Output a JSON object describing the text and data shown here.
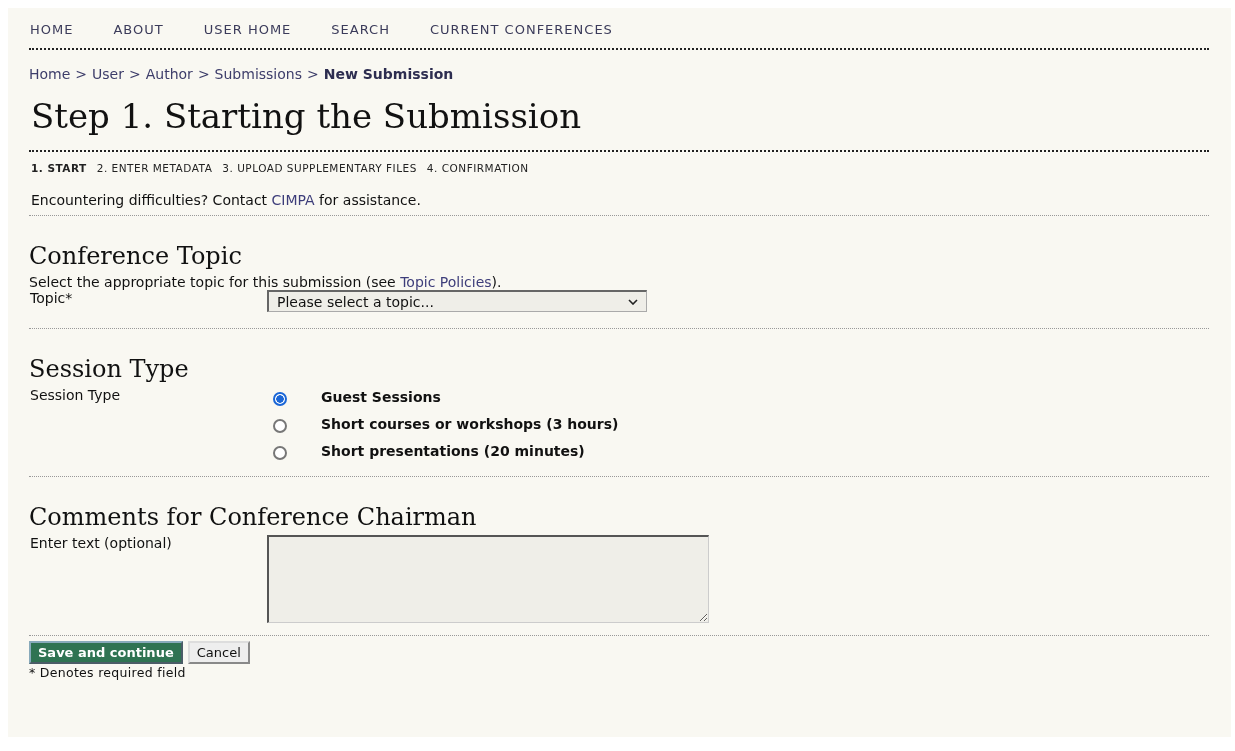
{
  "nav": [
    {
      "label": "HOME"
    },
    {
      "label": "ABOUT"
    },
    {
      "label": "USER HOME"
    },
    {
      "label": "SEARCH"
    },
    {
      "label": "CURRENT CONFERENCES"
    }
  ],
  "breadcrumb": [
    {
      "label": "Home",
      "current": false
    },
    {
      "label": "User",
      "current": false
    },
    {
      "label": "Author",
      "current": false
    },
    {
      "label": "Submissions",
      "current": false
    },
    {
      "label": "New Submission",
      "current": true
    }
  ],
  "breadcrumb_separator": ">",
  "title": "Step 1. Starting the Submission",
  "steps": [
    {
      "label": "1. START",
      "selected": true
    },
    {
      "label": "2. ENTER METADATA",
      "selected": false
    },
    {
      "label": "3. UPLOAD SUPPLEMENTARY FILES",
      "selected": false
    },
    {
      "label": "4. CONFIRMATION",
      "selected": false
    }
  ],
  "help": {
    "before": "Encountering difficulties? Contact ",
    "link": "CIMPA",
    "after": " for assistance."
  },
  "topic_section": {
    "heading": "Conference Topic",
    "intro_before": "Select the appropriate topic for this submission (see ",
    "intro_link": "Topic Policies",
    "intro_after": ").",
    "label": "Topic*",
    "select": {
      "value": "Please select a topic..."
    }
  },
  "session_section": {
    "heading": "Session Type",
    "label": "Session Type",
    "options": [
      {
        "label": "Guest Sessions",
        "selected": true
      },
      {
        "label": "Short courses or workshops (3 hours)",
        "selected": false
      },
      {
        "label": "Short presentations (20 minutes)",
        "selected": false
      }
    ]
  },
  "comments_section": {
    "heading": "Comments for Conference Chairman",
    "label": "Enter text (optional)"
  },
  "buttons": [
    {
      "label": "Save and continue",
      "kind": "primary"
    },
    {
      "label": "Cancel",
      "kind": "secondary"
    }
  ],
  "footnote": "* Denotes required field"
}
